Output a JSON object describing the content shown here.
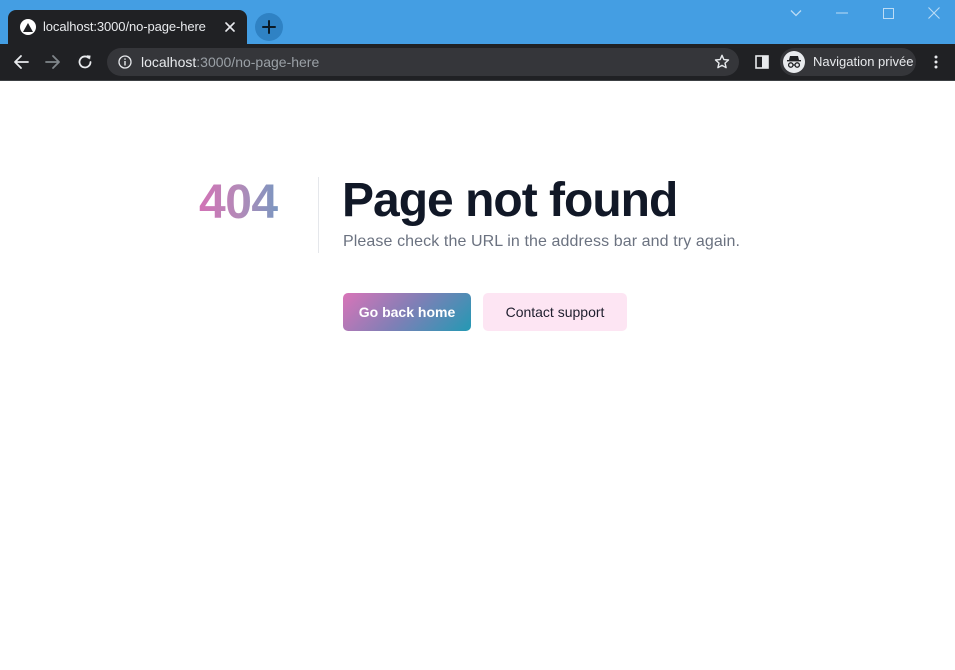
{
  "browser": {
    "tab": {
      "title": "localhost:3000/no-page-here"
    },
    "address_bar": {
      "host": "localhost",
      "path": ":3000/no-page-here"
    },
    "profile": {
      "label": "Navigation privée"
    },
    "icons": {
      "favicon": "triangle-favicon-icon",
      "close": "close-icon",
      "new_tab": "plus-icon",
      "back": "arrow-left-icon",
      "forward": "arrow-right-icon",
      "reload": "reload-icon",
      "info": "info-icon",
      "bookmark": "star-icon",
      "side_panel": "side-panel-icon",
      "incognito": "incognito-icon",
      "menu": "kebab-menu-icon"
    },
    "colors": {
      "tabstrip": "#449ee3",
      "toolbar": "#202124",
      "omnibox": "#35363a"
    }
  },
  "page": {
    "code": "404",
    "title": "Page not found",
    "subtitle": "Please check the URL in the address bar and try again.",
    "primary_button": "Go back home",
    "secondary_button": "Contact support",
    "colors": {
      "title": "#111827",
      "subtitle": "#6b7280",
      "secondary_bg": "#fde5f3"
    }
  }
}
